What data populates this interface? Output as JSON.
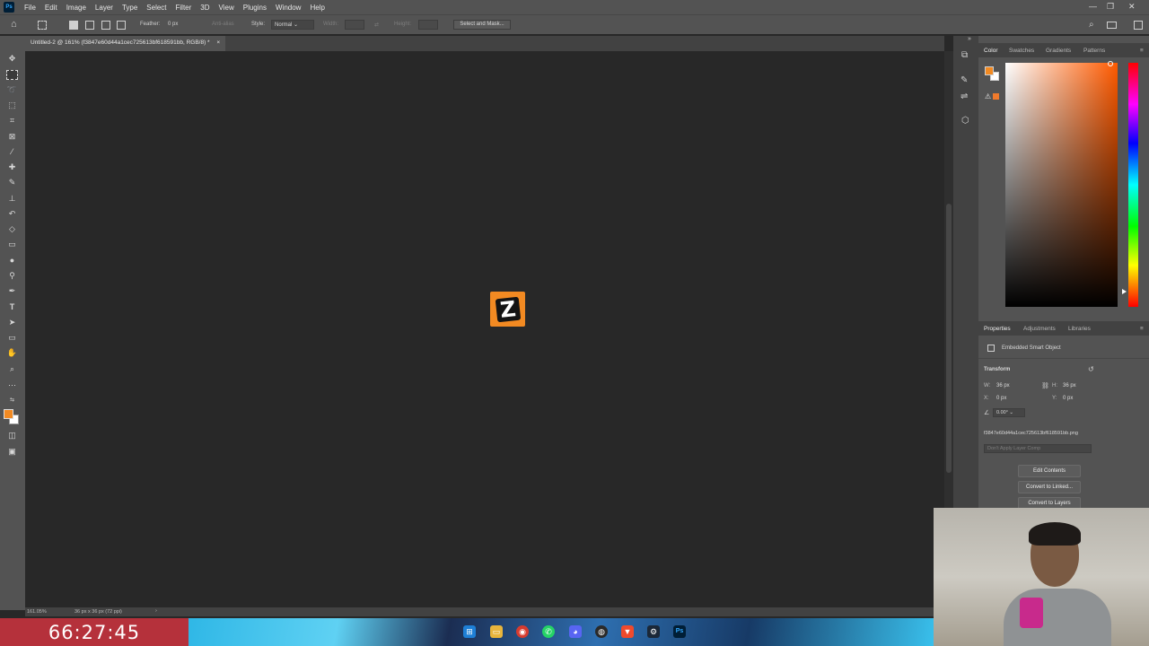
{
  "menubar": {
    "items": [
      "File",
      "Edit",
      "Image",
      "Layer",
      "Type",
      "Select",
      "Filter",
      "3D",
      "View",
      "Plugins",
      "Window",
      "Help"
    ]
  },
  "options": {
    "feather_label": "Feather:",
    "feather_value": "0 px",
    "antialias_label": "Anti-alias",
    "style_label": "Style:",
    "style_value": "Normal",
    "width_label": "Width:",
    "height_label": "Height:",
    "select_mask_label": "Select and Mask..."
  },
  "document": {
    "tab_title": "Untitled-2 @ 161% (f3847e60d44a1cec725613bf618591bb, RGB/8) *",
    "close_glyph": "×"
  },
  "statusbar": {
    "zoom": "161.05%",
    "doc_info": "36 px x 36 px (72 ppi)"
  },
  "color_panel": {
    "tabs": [
      "Color",
      "Swatches",
      "Gradients",
      "Patterns"
    ],
    "foreground_color": "#f28a22",
    "background_color": "#ffffff"
  },
  "properties_panel": {
    "tabs": [
      "Properties",
      "Adjustments",
      "Libraries"
    ],
    "object_type": "Embedded Smart Object",
    "section": "Transform",
    "w_label": "W:",
    "w_value": "36 px",
    "h_label": "H:",
    "h_value": "36 px",
    "x_label": "X:",
    "x_value": "0 px",
    "y_label": "Y:",
    "y_value": "0 px",
    "angle_value": "0.00°",
    "filename": "f3847e60d44a1cec725613bf618591bb.png",
    "layer_comp": "Don't Apply Layer Comp",
    "buttons": [
      "Edit Contents",
      "Convert to Linked...",
      "Convert to Layers"
    ]
  },
  "canvas": {
    "object_glyph": "Z"
  },
  "overlay": {
    "timer": "66:27:45"
  }
}
